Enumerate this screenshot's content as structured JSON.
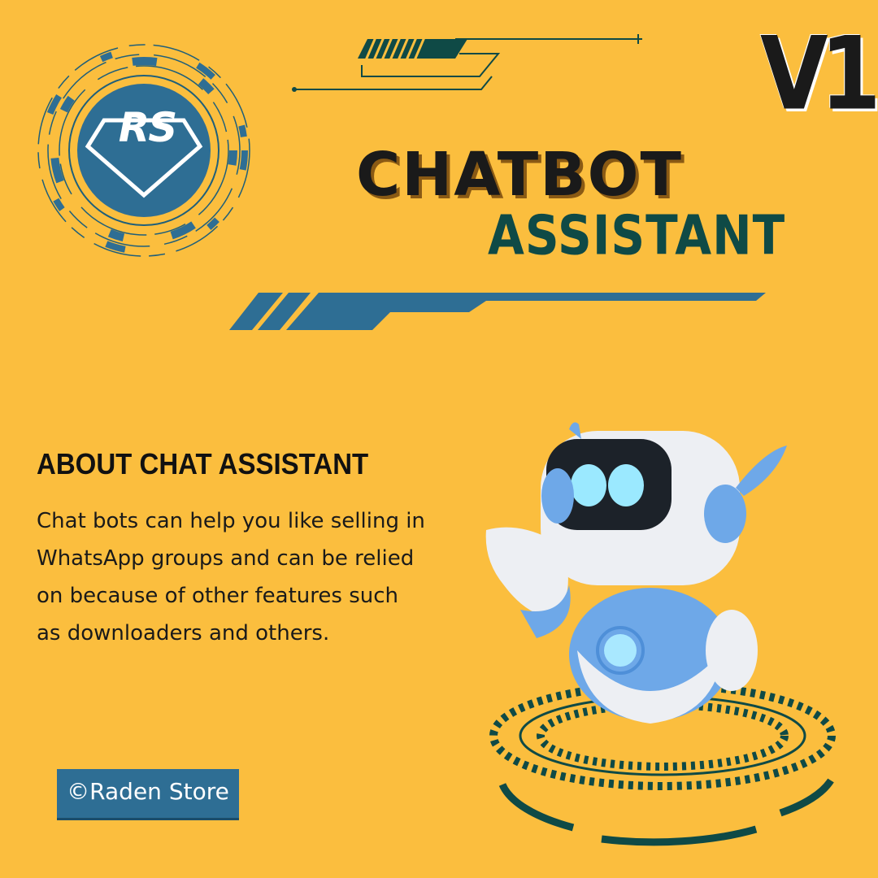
{
  "logo": {
    "text": "RS"
  },
  "version": "V1",
  "title": "CHATBOT",
  "subtitle": "ASSISTANT",
  "about": {
    "heading": "ABOUT CHAT ASSISTANT",
    "text": "Chat bots can help you like selling in WhatsApp groups and can be relied on because of other features such as downloaders and others."
  },
  "copyright": "©Raden Store",
  "colors": {
    "background": "#FBBE3E",
    "dark_teal": "#0F4A46",
    "blue": "#2E6E94",
    "robot_blue": "#6EA8E8"
  }
}
